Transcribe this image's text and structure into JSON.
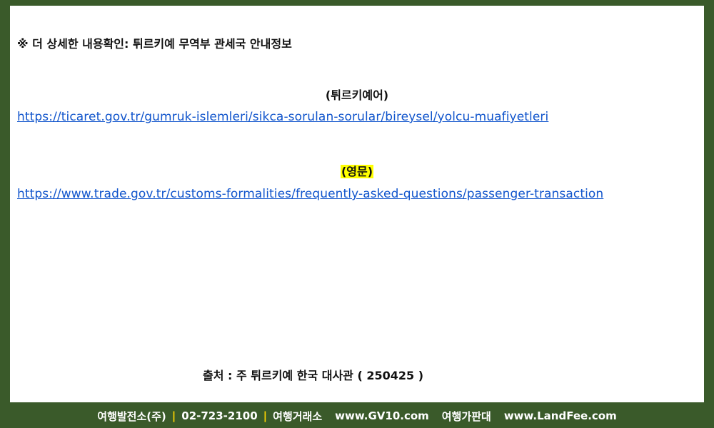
{
  "notice": "※ 더 상세한 내용확인: 튀르키예 무역부 관세국 안내정보",
  "sections": [
    {
      "heading": "(튀르키예어)",
      "url": "https://ticaret.gov.tr/gumruk-islemleri/sikca-sorulan-sorular/bireysel/yolcu-muafiyetleri"
    },
    {
      "heading": "(영문)",
      "url": "https://www.trade.gov.tr/customs-formalities/frequently-asked-questions/passenger-transaction"
    }
  ],
  "source": "출처 : 주 튀르키예 한국 대사관 ( 250425 )",
  "footer": {
    "company": "여행발전소(주)",
    "separator": "|",
    "phone": "02-723-2100",
    "label1": "여행거래소",
    "site1": "www.GV10.com",
    "label2": "여행가판대",
    "site2": "www.LandFee.com"
  },
  "colors": {
    "frame": "#3a5a2a",
    "link": "#1155cc",
    "highlight": "#ffff00",
    "separator": "#ffd400"
  }
}
